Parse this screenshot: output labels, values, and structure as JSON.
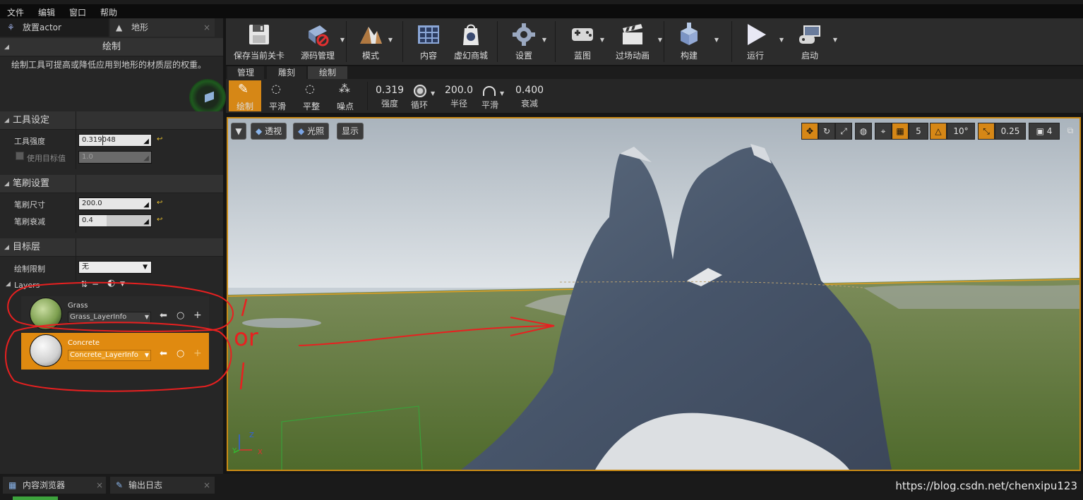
{
  "menu": [
    "文件",
    "编辑",
    "窗口",
    "帮助"
  ],
  "left_tabs": [
    {
      "label": "放置actor",
      "icon": "placement-icon"
    },
    {
      "label": "地形",
      "icon": "landscape-icon"
    }
  ],
  "panel": {
    "header": "绘制",
    "description": "绘制工具可提高或降低应用到地形的材质层的权重。",
    "sections": {
      "tool": {
        "title": "工具设定",
        "strength_label": "工具强度",
        "strength_value": "0.319048",
        "target_label": "使用目标值",
        "target_value": "1.0"
      },
      "brush": {
        "title": "笔刷设置",
        "size_label": "笔刷尺寸",
        "size_value": "200.0",
        "falloff_label": "笔刷衰减",
        "falloff_value": "0.4"
      },
      "target": {
        "title": "目标层",
        "restrict_label": "绘制限制",
        "restrict_value": "无",
        "layers_label": "Layers"
      }
    },
    "layers": [
      {
        "name": "Grass",
        "info": "Grass_LayerInfo",
        "selected": false
      },
      {
        "name": "Concrete",
        "info": "Concrete_LayerInfo",
        "selected": true
      }
    ],
    "annotation": "or"
  },
  "toolbar": [
    {
      "label": "保存当前关卡",
      "icon": "save-icon",
      "dropdown": false
    },
    {
      "label": "源码管理",
      "icon": "source-control-icon",
      "dropdown": true
    },
    {
      "label": "模式",
      "icon": "modes-icon",
      "dropdown": true
    },
    {
      "label": "内容",
      "icon": "content-icon",
      "dropdown": false
    },
    {
      "label": "虚幻商城",
      "icon": "marketplace-icon",
      "dropdown": false
    },
    {
      "label": "设置",
      "icon": "settings-icon",
      "dropdown": true
    },
    {
      "label": "蓝图",
      "icon": "blueprint-icon",
      "dropdown": true
    },
    {
      "label": "过场动画",
      "icon": "cinematics-icon",
      "dropdown": true
    },
    {
      "label": "构建",
      "icon": "build-icon",
      "dropdown": true
    },
    {
      "label": "运行",
      "icon": "play-icon",
      "dropdown": true
    },
    {
      "label": "启动",
      "icon": "launch-icon",
      "dropdown": true
    }
  ],
  "mode_tabs": [
    "管理",
    "雕刻",
    "绘制"
  ],
  "landscape_tools": [
    {
      "label": "绘制",
      "icon": "paint-brush-icon",
      "active": true
    },
    {
      "label": "平滑",
      "icon": "smooth-icon",
      "active": false
    },
    {
      "label": "平整",
      "icon": "flatten-icon",
      "active": false
    },
    {
      "label": "噪点",
      "icon": "noise-icon",
      "active": false
    }
  ],
  "landscape_values": [
    {
      "value": "0.319",
      "label": "强度"
    },
    {
      "value": "",
      "label": "循环"
    },
    {
      "value": "200.0",
      "label": "半径"
    },
    {
      "value": "",
      "label": "平滑"
    },
    {
      "value": "0.400",
      "label": "衰减"
    }
  ],
  "viewport": {
    "left_buttons": [
      "透视",
      "光照",
      "显示"
    ],
    "grid_value": "5",
    "angle_value": "10°",
    "scale_value": "0.25",
    "camera_speed": "4",
    "axis_labels": [
      "Z",
      "Y",
      "X"
    ]
  },
  "bottom_tabs": [
    {
      "label": "内容浏览器",
      "icon": "content-browser-icon"
    },
    {
      "label": "输出日志",
      "icon": "output-log-icon"
    }
  ],
  "watermark": "https://blog.csdn.net/chenxipu123",
  "colors": {
    "accent": "#d68716",
    "selected_layer": "#e08a10",
    "annotation": "#e82020"
  }
}
